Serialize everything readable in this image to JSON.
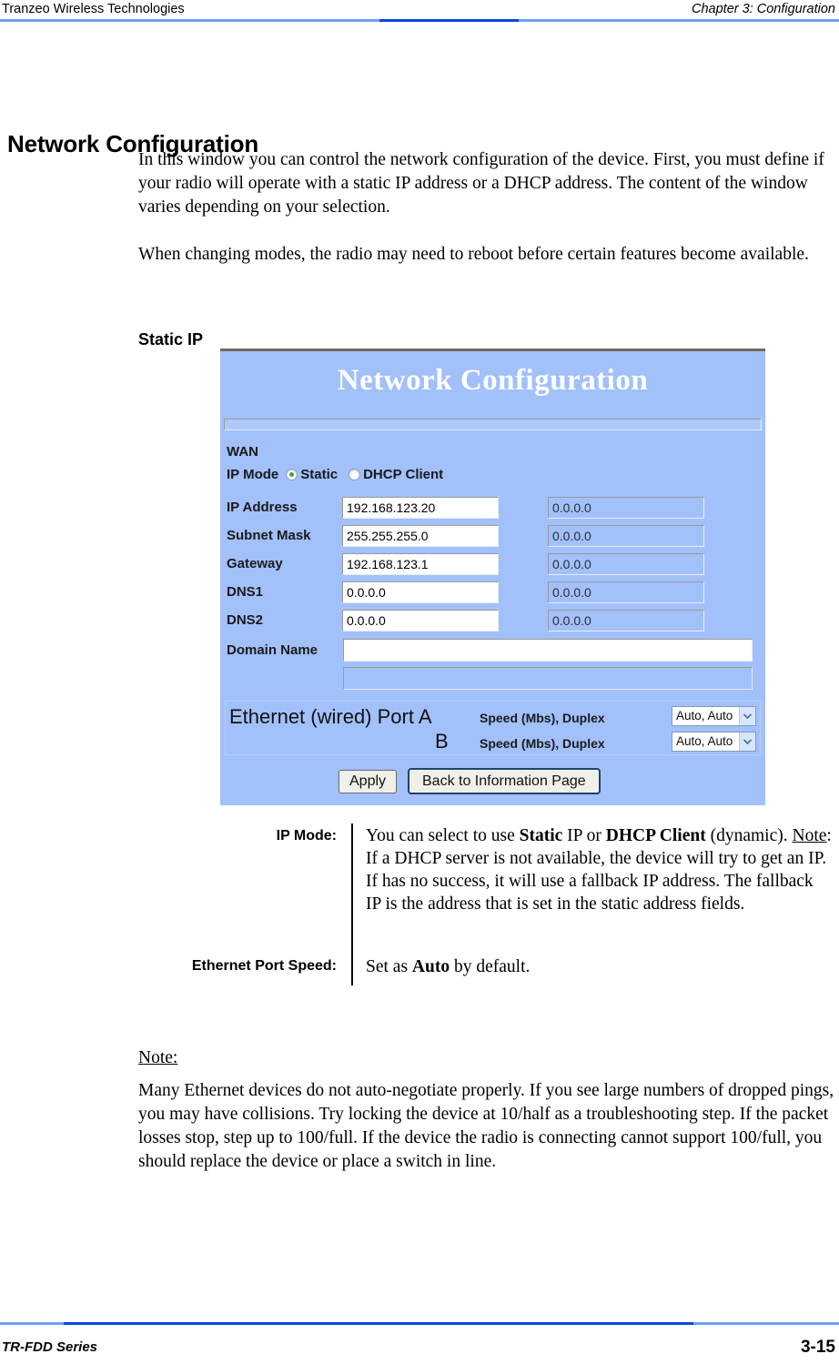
{
  "header": {
    "left_text": "Tranzeo Wireless Technologies",
    "right_text": "Chapter 3: Configuration"
  },
  "section": {
    "title": "Network Configuration",
    "paragraph_1": "In this window you can control the network configuration of the device. First, you must define if your radio will operate with a static IP address or a DHCP address. The content of the window varies depending on your selection.",
    "paragraph_2": "When changing modes, the radio may need to reboot before certain features become available.",
    "subheading": "Static IP"
  },
  "app_screenshot": {
    "title": "Network Configuration",
    "wan_label": "WAN",
    "ip_mode": {
      "label": "IP Mode",
      "options": [
        "Static",
        "DHCP Client"
      ],
      "selected": "Static"
    },
    "fields": [
      {
        "label": "IP Address",
        "static_value": "192.168.123.20",
        "dhcp_value": "0.0.0.0"
      },
      {
        "label": "Subnet Mask",
        "static_value": "255.255.255.0",
        "dhcp_value": "0.0.0.0"
      },
      {
        "label": "Gateway",
        "static_value": "192.168.123.1",
        "dhcp_value": "0.0.0.0"
      },
      {
        "label": "DNS1",
        "static_value": "0.0.0.0",
        "dhcp_value": "0.0.0.0"
      },
      {
        "label": "DNS2",
        "static_value": "0.0.0.0",
        "dhcp_value": "0.0.0.0"
      }
    ],
    "domain_name": {
      "label": "Domain Name",
      "value_enabled": "",
      "value_disabled": ""
    },
    "ethernet": {
      "title": "Ethernet (wired) Port A",
      "port_b_label": "B",
      "speed_label_a": "Speed (Mbs), Duplex",
      "speed_label_b": "Speed (Mbs), Duplex",
      "speed_value_a": "Auto, Auto",
      "speed_value_b": "Auto, Auto"
    },
    "buttons": {
      "apply": "Apply",
      "back": "Back to Information Page"
    },
    "colors": {
      "panel_background": "#a2c0fa",
      "panel_title_text": "#ffffff",
      "radio_selected_dot": "#3ea24a",
      "select_arrow_button": "#d7e5fb",
      "back_button_border": "#1b4470"
    }
  },
  "definitions": [
    {
      "term": "IP Mode:",
      "description_parts": [
        {
          "text": "You can select to use ",
          "style": "normal"
        },
        {
          "text": "Static",
          "style": "bold"
        },
        {
          "text": " IP or ",
          "style": "normal"
        },
        {
          "text": "DHCP Client",
          "style": "bold"
        },
        {
          "text": " (dynamic). ",
          "style": "normal"
        },
        {
          "text": "Note",
          "style": "underline"
        },
        {
          "text": ": If a DHCP server is not available, the device will try to get an IP. If has no success, it will use a fallback IP address.  The fallback IP is the address that is set in the static address fields.",
          "style": "normal"
        }
      ]
    },
    {
      "term": "Ethernet Port Speed:",
      "description_parts": [
        {
          "text": "Set as ",
          "style": "normal"
        },
        {
          "text": "Auto",
          "style": "bold"
        },
        {
          "text": " by default.",
          "style": "normal"
        }
      ]
    }
  ],
  "note": {
    "label": "Note:",
    "body": "Many Ethernet devices do not auto-negotiate properly. If you see large numbers of dropped pings, you may have collisions. Try locking the device at 10/half as a troubleshooting step. If the packet losses stop, step up to 100/full. If the device the radio is connecting cannot support 100/full, you should replace the device or place a switch in line."
  },
  "footer": {
    "left_text": "TR-FDD Series",
    "page_number": "3-15"
  }
}
